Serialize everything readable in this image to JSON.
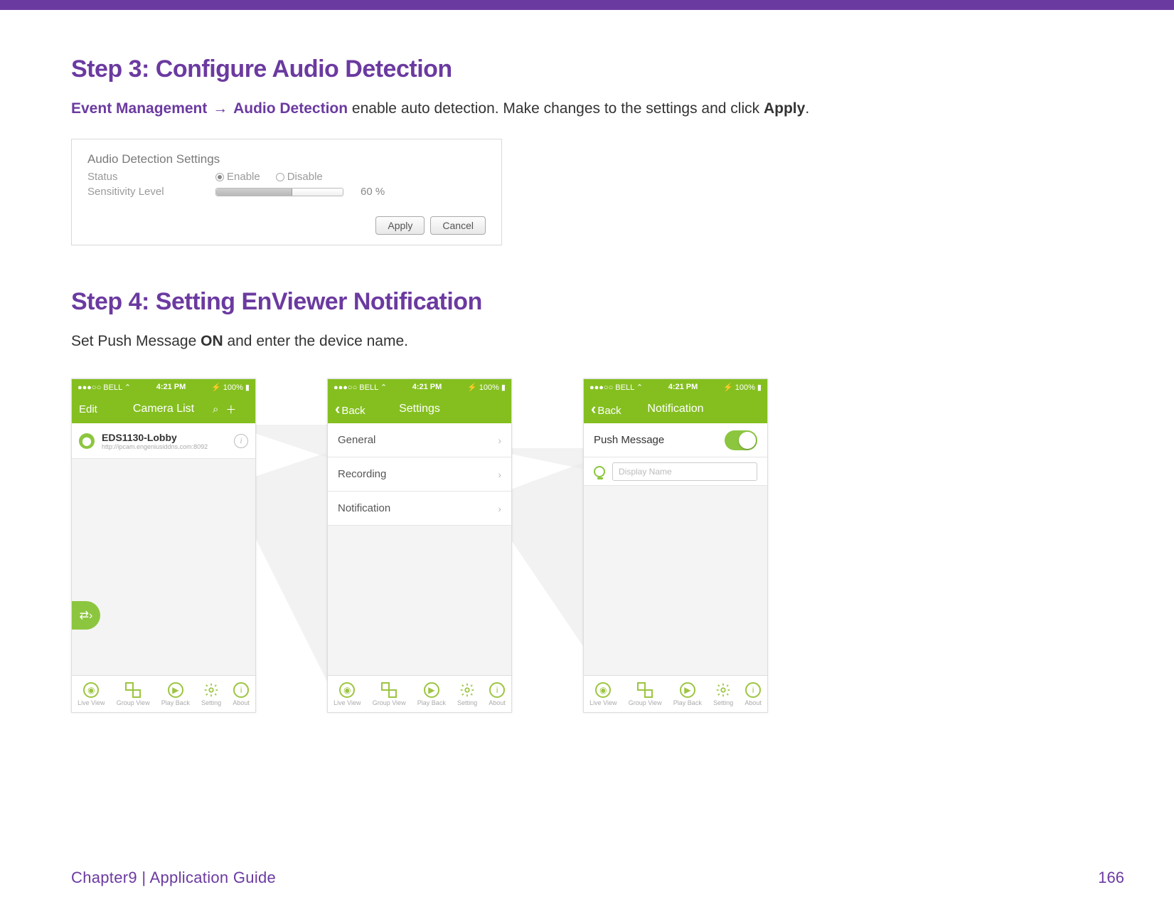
{
  "step3": {
    "heading": "Step 3: Configure Audio Detection",
    "crumb1": "Event Management",
    "arrow": "→",
    "crumb2": "Audio Detection",
    "tail": " enable auto detection. Make changes to the settings and click ",
    "apply": "Apply",
    "period": "."
  },
  "audio_panel": {
    "title": "Audio Detection Settings",
    "row_status_label": "Status",
    "enable": "Enable",
    "disable": "Disable",
    "row_sens_label": "Sensitivity Level",
    "value": "60 %",
    "apply_btn": "Apply",
    "cancel_btn": "Cancel"
  },
  "step4": {
    "heading": "Step 4: Setting EnViewer Notification",
    "text_pre": "Set Push Message ",
    "on": "ON",
    "text_post": " and enter the device name."
  },
  "status": {
    "carrier": "●●●○○ BELL ⌃",
    "time": "4:21 PM",
    "batt": "⚡ 100% ▮"
  },
  "phone1": {
    "left": "Edit",
    "title": "Camera List",
    "cam_name": "EDS1130-Lobby",
    "cam_sub": "http://ipcam.engeniusiddns.com:8092"
  },
  "phone2": {
    "back": "Back",
    "title": "Settings",
    "items": [
      "General",
      "Recording",
      "Notification"
    ]
  },
  "phone3": {
    "back": "Back",
    "title": "Notification",
    "push": "Push Message",
    "placeholder": "Display Name"
  },
  "tabs": {
    "live": "Live View",
    "group": "Group View",
    "play": "Play Back",
    "setting": "Setting",
    "about": "About"
  },
  "footer": {
    "chapter": "Chapter9  |  Application Guide",
    "page": "166"
  }
}
